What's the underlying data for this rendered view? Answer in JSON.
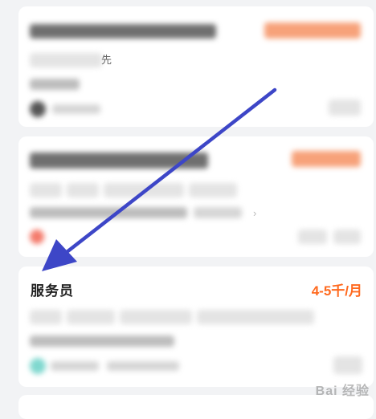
{
  "cards": [
    {
      "tag_visible_char": "先"
    },
    {
      "chevron": "›"
    },
    {
      "title": "服务员",
      "salary": "4-5千/月"
    }
  ],
  "watermark": "Bai 经验",
  "colors": {
    "salary": "#ff6a1f",
    "arrow": "#3d46c7",
    "background": "#f2f3f5"
  }
}
